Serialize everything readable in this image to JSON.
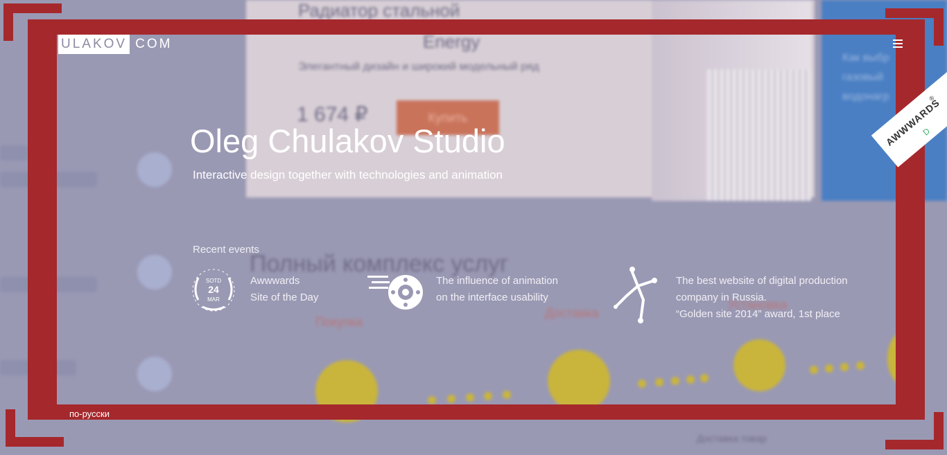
{
  "header": {
    "logo_left": "ULAKOV",
    "logo_right": "COM",
    "menu_icon": "menu-icon"
  },
  "hero": {
    "title": "Oleg Chulakov Studio",
    "subtitle": "Interactive design together with technologies and animation"
  },
  "events": {
    "heading": "Recent events",
    "items": [
      {
        "badge": {
          "top": "SOTD",
          "day": "24",
          "month": "MAR"
        },
        "lines": [
          "Awwwards",
          "Site of the Day"
        ],
        "icon": "laurel-badge-icon"
      },
      {
        "lines": [
          "The influence of animation",
          "on the interface usability"
        ],
        "icon": "speeding-wheel-icon"
      },
      {
        "lines": [
          "The best website of digital production",
          "company in Russia.",
          "“Golden site 2014” award, 1st place"
        ],
        "icon": "dancer-figure-icon"
      }
    ]
  },
  "footer": {
    "lang_link": "по-русски"
  },
  "ribbon": {
    "text": "AWWWARDS",
    "mark": "®",
    "sub": "D"
  },
  "background": {
    "product_title": "Радиатор стальной",
    "product_sub": "Energy",
    "product_desc": "Элегантный дизайн и широкий модельный ряд",
    "price": "1 674 ₽",
    "buy": "Купить",
    "services": "Полный комплекс услуг",
    "step_purchase": "Покупка",
    "step_delivery": "Доставка",
    "step_install": "Установка",
    "blue_text": [
      "Как выбр",
      "газовый",
      "водонагр"
    ],
    "bottom_text": "Доставка товар"
  },
  "colors": {
    "frame": "#a5282c",
    "overlay": "#9a99b4",
    "accent_yellow": "#c9b53c"
  }
}
